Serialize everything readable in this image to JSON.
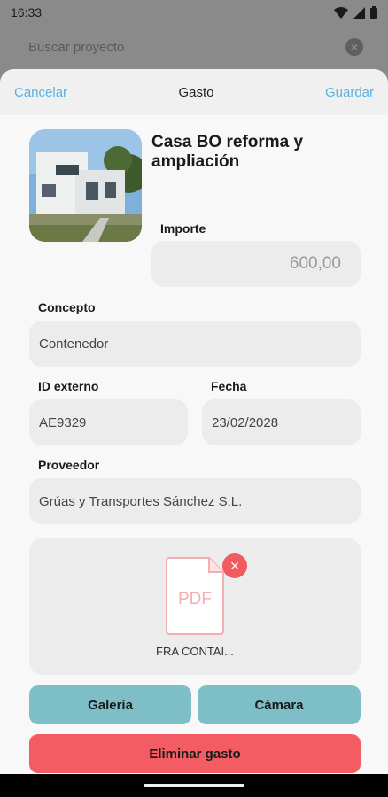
{
  "status_bar": {
    "time": "16:33"
  },
  "background": {
    "search_placeholder": "Buscar proyecto",
    "clear_symbol": "×"
  },
  "header": {
    "cancel_label": "Cancelar",
    "title": "Gasto",
    "save_label": "Guardar"
  },
  "project": {
    "title": "Casa BO reforma y ampliación",
    "photo_icon": "house-photo"
  },
  "form": {
    "amount_label": "Importe",
    "amount_value": "600,00",
    "concept_label": "Concepto",
    "concept_value": "Contenedor",
    "external_id_label": "ID externo",
    "external_id_value": "AE9329",
    "date_label": "Fecha",
    "date_value": "23/02/2028",
    "provider_label": "Proveedor",
    "provider_value": "Grúas y Transportes Sánchez S.L."
  },
  "attachment": {
    "type_label": "PDF",
    "file_name": "FRA CONTAI...",
    "remove_symbol": "×"
  },
  "buttons": {
    "gallery": "Galería",
    "camera": "Cámara",
    "delete": "Eliminar gasto"
  },
  "colors": {
    "accent": "#5ab2e0",
    "teal": "#7ebfc7",
    "danger": "#f35c62"
  }
}
